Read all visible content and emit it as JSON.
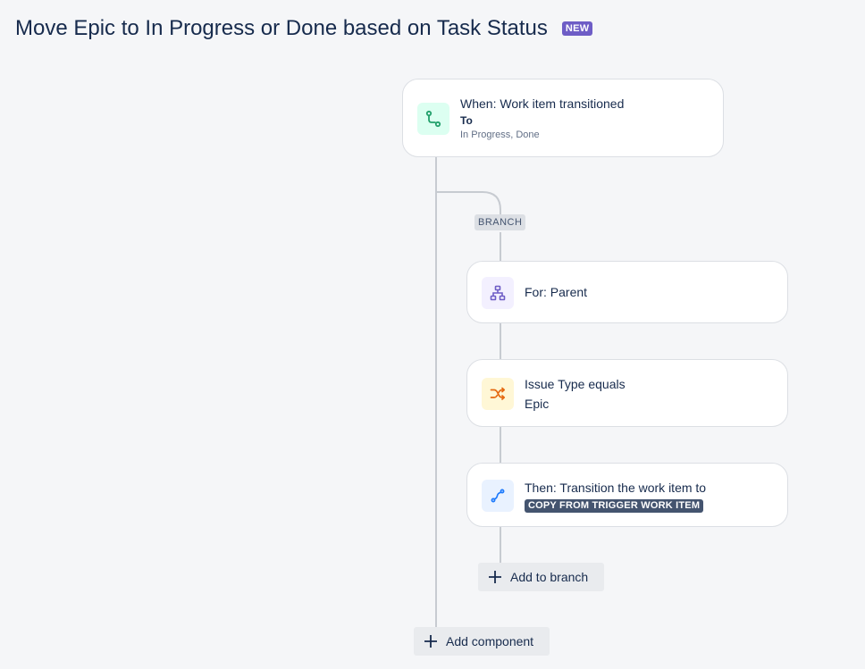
{
  "header": {
    "title": "Move Epic to In Progress or Done based on Task Status",
    "badge": "NEW"
  },
  "trigger": {
    "title": "When: Work item transitioned",
    "field_label": "To",
    "field_value": "In Progress, Done",
    "icon": "transition-path-icon",
    "icon_color": "#22a06b",
    "tile_color": "#dcfff1"
  },
  "branch": {
    "label": "BRANCH",
    "for_card": {
      "title": "For: Parent",
      "icon": "hierarchy-icon",
      "icon_color": "#6e5dc6",
      "tile_color": "#f3f0ff"
    },
    "condition_card": {
      "title": "Issue Type equals",
      "value": "Epic",
      "icon": "shuffle-icon",
      "icon_color": "#e56910",
      "tile_color": "#fff7d6"
    },
    "action_card": {
      "title": "Then: Transition the work item to",
      "lozenge": "COPY FROM TRIGGER WORK ITEM",
      "icon": "route-icon",
      "icon_color": "#1d7afc",
      "tile_color": "#e9f2ff"
    },
    "add_label": "Add to branch"
  },
  "footer": {
    "add_component_label": "Add component"
  }
}
